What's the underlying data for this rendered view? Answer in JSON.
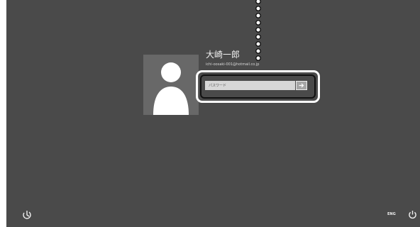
{
  "user": {
    "name": "大崎一郎",
    "email": "ichi-oosaki-001@hotmail.co.jp"
  },
  "login": {
    "password_placeholder": "パスワード",
    "password_value": "",
    "submit_icon": "arrow-right-icon"
  },
  "footer": {
    "ease_of_access_icon": "ease-of-access-icon",
    "language_label": "ENG",
    "power_icon": "power-icon"
  },
  "annotation": {
    "pointer": "dotted-leader-line",
    "highlight": "rounded-callout-frame"
  },
  "colors": {
    "background": "#4a4a4a",
    "avatar_tile": "#686868",
    "input_background": "#d7d7d7",
    "button_background": "#a6a6a6",
    "text_primary": "#f2f2f2"
  }
}
